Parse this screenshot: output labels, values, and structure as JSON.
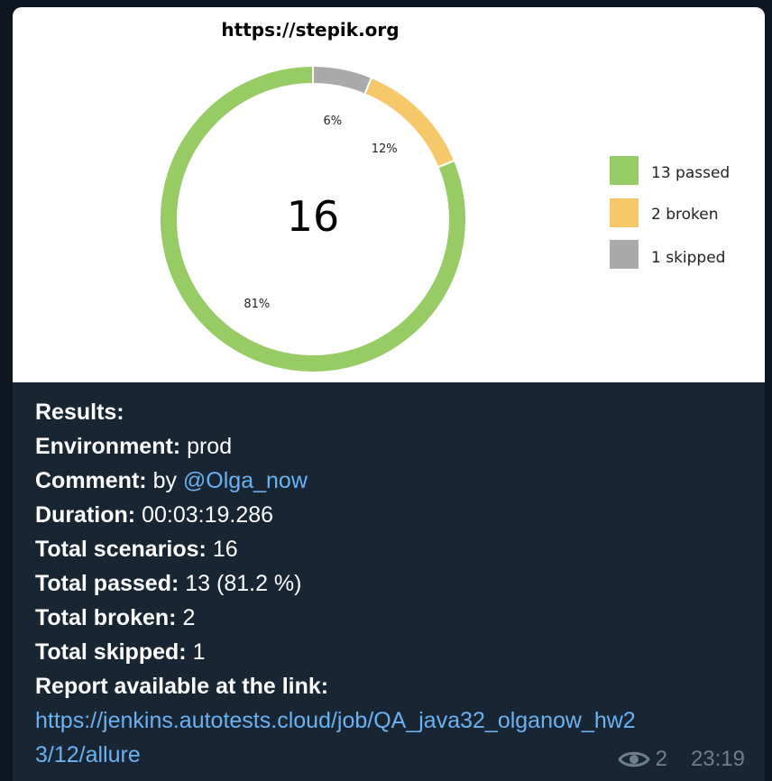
{
  "chart_data": {
    "type": "pie",
    "style": "donut",
    "title": "https://stepik.org",
    "center_label": "16",
    "slices": [
      {
        "name": "passed",
        "value": 13,
        "pct_label": "81%",
        "color": "#97cc64"
      },
      {
        "name": "broken",
        "value": 2,
        "pct_label": "12%",
        "color": "#f5c86a"
      },
      {
        "name": "skipped",
        "value": 1,
        "pct_label": "6%",
        "color": "#aaaaaa"
      }
    ],
    "legend": [
      "13 passed",
      "2 broken",
      "1 skipped"
    ],
    "legend_position": "right"
  },
  "message": {
    "results_label": "Results:",
    "environment_label": "Environment:",
    "environment_value": "prod",
    "comment_label": "Comment:",
    "comment_prefix": "by",
    "comment_mention": "@Olga_now",
    "duration_label": "Duration:",
    "duration_value": "00:03:19.286",
    "total_scenarios_label": "Total scenarios:",
    "total_scenarios_value": "16",
    "total_passed_label": "Total passed:",
    "total_passed_value": "13 (81.2 %)",
    "total_broken_label": "Total broken:",
    "total_broken_value": "2",
    "total_skipped_label": "Total skipped:",
    "total_skipped_value": "1",
    "report_label": "Report available at the link:",
    "report_link_line1": "https://jenkins.autotests.cloud/job/QA_java32_olganow_hw2",
    "report_link_line2": "3/12/allure"
  },
  "meta": {
    "views": "2",
    "time": "23:19",
    "views_icon": "eye-icon"
  }
}
